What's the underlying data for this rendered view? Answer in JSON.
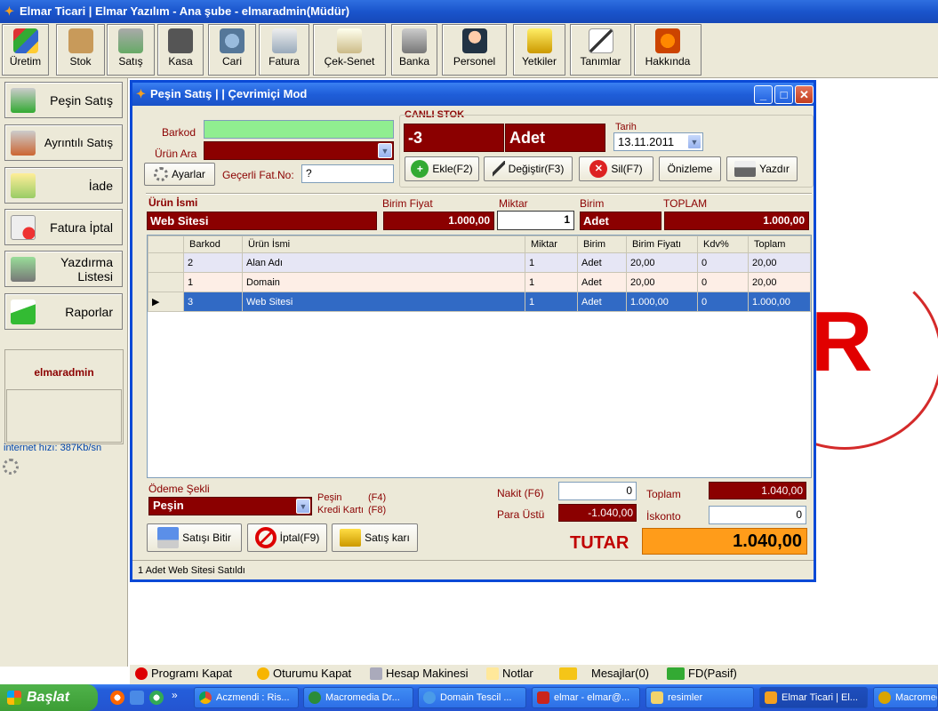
{
  "app": {
    "title": "Elmar Ticari | Elmar Yazılım - Ana şube - elmaradmin(Müdür)"
  },
  "toolbar": {
    "buttons": [
      {
        "label": "Üretim",
        "icon": "production-icon"
      },
      {
        "label": "Stok",
        "icon": "box-icon"
      },
      {
        "label": "Satış",
        "icon": "cart-icon"
      },
      {
        "label": "Kasa",
        "icon": "cash-register-icon"
      },
      {
        "label": "Cari",
        "icon": "people-icon"
      },
      {
        "label": "Fatura",
        "icon": "printer-icon"
      },
      {
        "label": "Çek-Senet",
        "icon": "document-icon"
      },
      {
        "label": "Banka",
        "icon": "bank-icon"
      },
      {
        "label": "Personel",
        "icon": "person-icon"
      },
      {
        "label": "Yetkiler",
        "icon": "lock-icon"
      },
      {
        "label": "Tanımlar",
        "icon": "pen-icon"
      },
      {
        "label": "Hakkında",
        "icon": "chair-icon"
      }
    ]
  },
  "sidebar": {
    "items": [
      {
        "label": "Peşin Satış",
        "icon": "cart-icon"
      },
      {
        "label": "Ayrıntılı Satış",
        "icon": "cart-detail-icon"
      },
      {
        "label": "İade",
        "icon": "folder-icon"
      },
      {
        "label": "Fatura İptal",
        "icon": "invoice-cancel-icon"
      },
      {
        "label": "Yazdırma Listesi",
        "icon": "print-list-icon"
      },
      {
        "label": "Raporlar",
        "icon": "chart-icon"
      }
    ],
    "user": "elmaradmin",
    "internet_speed": "internet hızı: 387Kb/sn"
  },
  "window": {
    "title": "Peşin Satış | | Çevrimiçi Mod",
    "barkod_label": "Barkod",
    "barkod_value": "",
    "urun_ara_label": "Ürün Ara",
    "ayarlar_label": "Ayarlar",
    "gecerli_fat_label": "Geçerli Fat.No:",
    "gecerli_fat_value": "?",
    "canli_stok_label": "CANLI STOK",
    "canli_stok_value": "-3",
    "canli_stok_unit": "Adet",
    "tarih_label": "Tarih",
    "tarih_value": "13.11.2011",
    "ekle_label": "Ekle(F2)",
    "degistir_label": "Değiştir(F3)",
    "sil_label": "Sil(F7)",
    "onizleme_label": "Önizleme",
    "yazdir_label": "Yazdır",
    "entry": {
      "urun_ismi_label": "Ürün İsmi",
      "urun_ismi_value": "Web Sitesi",
      "birim_fiyat_label": "Birim Fiyat",
      "birim_fiyat_value": "1.000,00",
      "miktar_label": "Miktar",
      "miktar_value": "1",
      "birim_label": "Birim",
      "birim_value": "Adet",
      "toplam_label": "TOPLAM",
      "toplam_value": "1.000,00"
    },
    "grid": {
      "columns": [
        "Barkod",
        "Ürün İsmi",
        "Miktar",
        "Birim",
        "Birim Fiyatı",
        "Kdv%",
        "Toplam"
      ],
      "rows": [
        {
          "barkod": "2",
          "urun": "Alan Adı",
          "miktar": "1",
          "birim": "Adet",
          "fiyat": "20,00",
          "kdv": "0",
          "toplam": "20,00"
        },
        {
          "barkod": "1",
          "urun": "Domain",
          "miktar": "1",
          "birim": "Adet",
          "fiyat": "20,00",
          "kdv": "0",
          "toplam": "20,00"
        },
        {
          "barkod": "3",
          "urun": "Web Sitesi",
          "miktar": "1",
          "birim": "Adet",
          "fiyat": "1.000,00",
          "kdv": "0",
          "toplam": "1.000,00"
        }
      ]
    },
    "payment": {
      "odeme_label": "Ödeme Şekli",
      "odeme_value": "Peşin",
      "pesin_hint": "Peşin",
      "pesin_key": "(F4)",
      "kredi_hint": "Kredi Kartı",
      "kredi_key": "(F8)",
      "nakit_label": "Nakit (F6)",
      "nakit_value": "0",
      "para_ustu_label": "Para Üstü",
      "para_ustu_value": "-1.040,00",
      "toplam_label": "Toplam",
      "toplam_value": "1.040,00",
      "iskonto_label": "İskonto",
      "iskonto_value": "0",
      "tutar_label": "TUTAR",
      "tutar_value": "1.040,00",
      "satisi_bitir_label": "Satışı Bitir",
      "iptal_label": "İptal(F9)",
      "satis_kari_label": "Satış karı"
    },
    "status": "1 Adet Web Sitesi Satıldı"
  },
  "bottom": {
    "programi_kapat": "Programı Kapat",
    "oturumu_kapat": "Oturumu Kapat",
    "hesap_makinesi": "Hesap Makinesi",
    "notlar": "Notlar",
    "mesajlar": "Mesajlar(0)",
    "fd": "FD(Pasif)"
  },
  "taskbar": {
    "start": "Başlat",
    "tasks": [
      "Aczmendi : Ris...",
      "Macromedia Dr...",
      "Domain Tescil ...",
      "elmar - elmar@...",
      "resimler",
      "Elmar Ticari | El...",
      "Macromed"
    ]
  },
  "colors": {
    "dark_red": "#8b0000",
    "tutar_orange": "#ff9c1a",
    "xp_blue": "#245edb",
    "selection": "#316ac5"
  }
}
